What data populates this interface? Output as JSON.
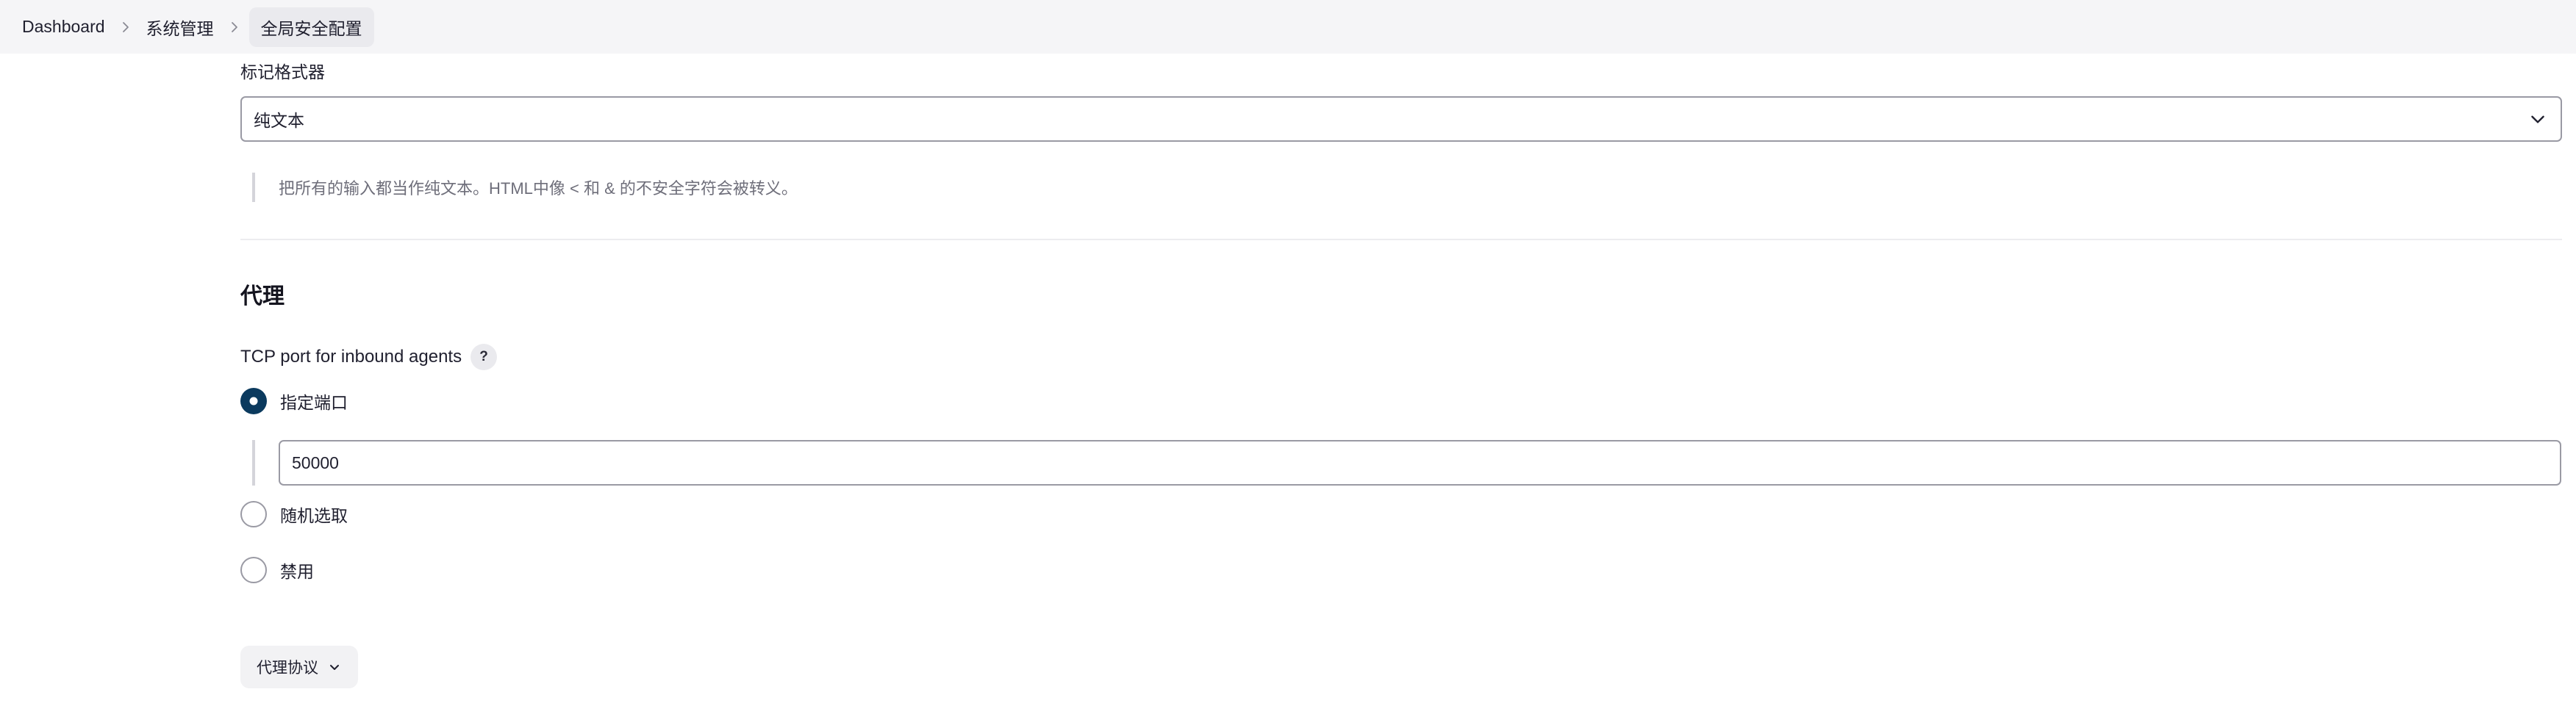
{
  "breadcrumb": {
    "items": [
      "Dashboard",
      "系统管理",
      "全局安全配置"
    ]
  },
  "markup_formatter": {
    "label": "标记格式器",
    "selected": "纯文本",
    "help": "把所有的输入都当作纯文本。HTML中像 < 和 & 的不安全字符会被转义。"
  },
  "agents": {
    "section_title": "代理",
    "tcp_label": "TCP port for inbound agents",
    "help_icon_text": "?",
    "options": [
      {
        "label": "指定端口",
        "checked": true
      },
      {
        "label": "随机选取",
        "checked": false
      },
      {
        "label": "禁用",
        "checked": false
      }
    ],
    "port_value": "50000",
    "protocols_button": "代理协议"
  },
  "colors": {
    "radio_checked": "#0b3a5e",
    "topbar_bg": "#f5f5f7"
  }
}
